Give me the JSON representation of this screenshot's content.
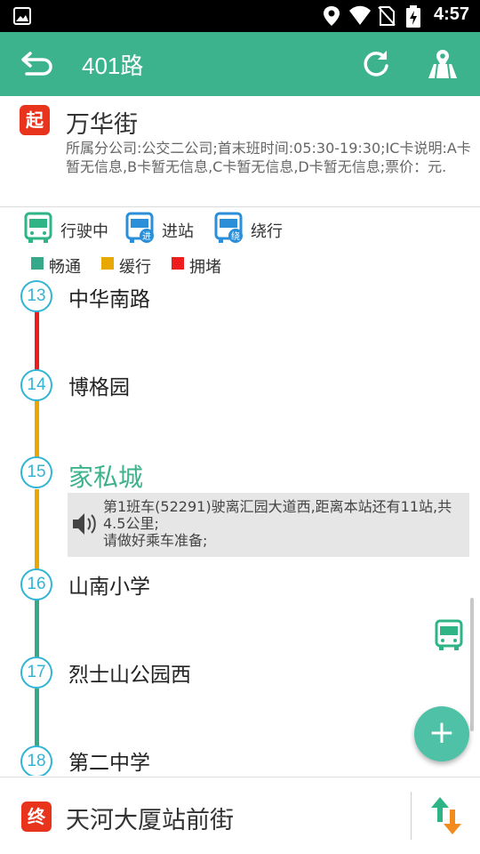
{
  "status_bar": {
    "time": "4:57"
  },
  "toolbar": {
    "title": "401路"
  },
  "start": {
    "badge": "起",
    "name": "万华街",
    "description": "所属分公司:公交二公司;首末班时间:05:30-19:30;IC卡说明:A卡暂无信息,B卡暂无信息,C卡暂无信息,D卡暂无信息;票价：元."
  },
  "bus_legend": [
    {
      "label": "行驶中",
      "icon": "bus-green-icon"
    },
    {
      "label": "进站",
      "icon": "bus-arriving-icon",
      "sub": "进"
    },
    {
      "label": "绕行",
      "icon": "bus-detour-icon",
      "sub": "绕"
    }
  ],
  "traffic_legend": [
    {
      "label": "畅通",
      "color": "#35a98a"
    },
    {
      "label": "缓行",
      "color": "#e8a800"
    },
    {
      "label": "拥堵",
      "color": "#ee1c1c"
    }
  ],
  "stations": [
    {
      "num": "13",
      "name": "中华南路"
    },
    {
      "num": "14",
      "name": "博格园"
    },
    {
      "num": "15",
      "name": "家私城"
    },
    {
      "num": "16",
      "name": "山南小学"
    },
    {
      "num": "17",
      "name": "烈士山公园西"
    },
    {
      "num": "18",
      "name": "第二中学"
    }
  ],
  "segment_colors": [
    "#ee1c1c",
    "#e8a800",
    "#e8a800",
    "#35a98a",
    "#35a98a"
  ],
  "arrival_info": {
    "line1": "第1班车(52291)驶离汇园大道西,距离本站还有11站,共4.5公里;",
    "line2": "请做好乘车准备;"
  },
  "fab": {
    "label": "+"
  },
  "end": {
    "badge": "终",
    "name": "天河大厦站前街"
  }
}
